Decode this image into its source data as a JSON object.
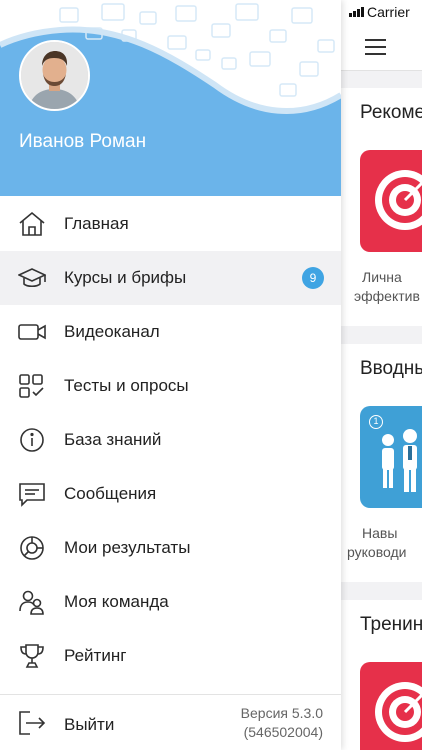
{
  "status_bar": {
    "carrier": "Carrier"
  },
  "user": {
    "name": "Иванов Роман"
  },
  "menu": [
    {
      "label": "Главная",
      "icon": "home-icon"
    },
    {
      "label": "Курсы и брифы",
      "icon": "graduation-cap-icon",
      "badge": "9",
      "active": true
    },
    {
      "label": "Видеоканал",
      "icon": "video-camera-icon"
    },
    {
      "label": "Тесты и опросы",
      "icon": "tests-grid-icon"
    },
    {
      "label": "База знаний",
      "icon": "info-icon"
    },
    {
      "label": "Сообщения",
      "icon": "message-icon"
    },
    {
      "label": "Мои результаты",
      "icon": "results-chart-icon"
    },
    {
      "label": "Моя команда",
      "icon": "team-icon"
    },
    {
      "label": "Рейтинг",
      "icon": "trophy-icon"
    }
  ],
  "footer": {
    "logout_label": "Выйти",
    "version_line1": "Версия 5.3.0",
    "version_line2": "(546502004)"
  },
  "background": {
    "sections": [
      {
        "title": "Рекоме",
        "card_color": "#e6304a",
        "card_icon": "target-icon",
        "caption_line1": "Лична",
        "caption_line2": "эффектив"
      },
      {
        "title": "Вводны",
        "card_color": "#3fa0d6",
        "card_icon": "business-people-icon",
        "card_number": "1",
        "caption_line1": "Навы",
        "caption_line2": "руководи"
      },
      {
        "title": "Тренин",
        "card_color": "#e6304a",
        "card_icon": "target-icon"
      }
    ]
  },
  "colors": {
    "header": "#6bb4ea",
    "badge": "#3fa4e3",
    "active_row": "#f1f1f3"
  }
}
